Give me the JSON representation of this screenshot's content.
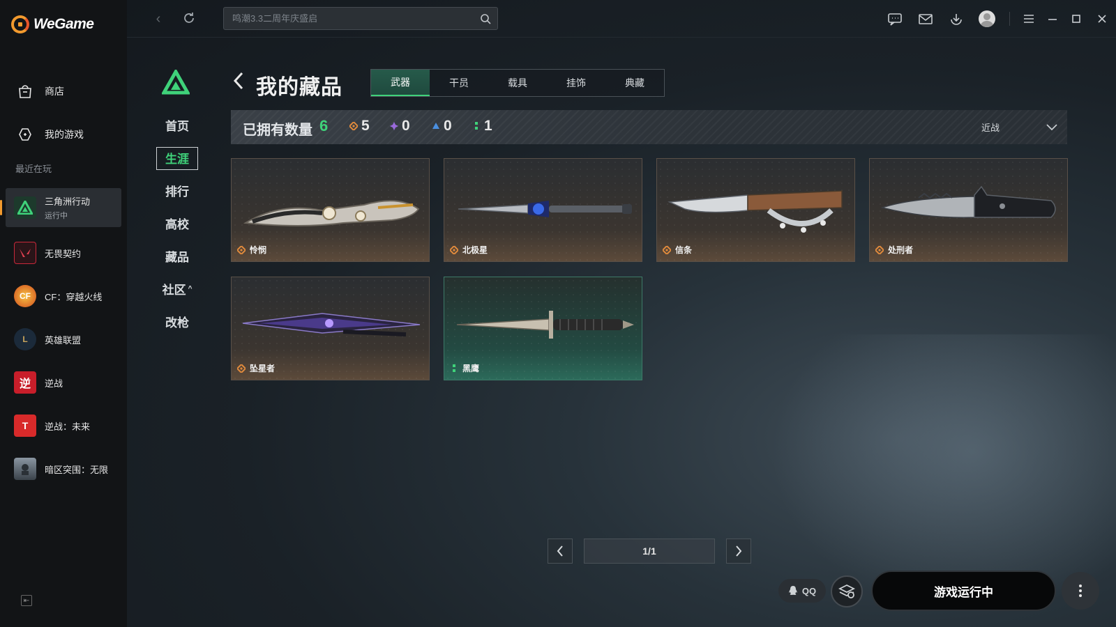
{
  "app": {
    "name": "WeGame"
  },
  "sidebar": {
    "nav": [
      {
        "label": "商店",
        "icon": "shop-bag-icon"
      },
      {
        "label": "我的游戏",
        "icon": "gamepad-icon"
      }
    ],
    "recent_title": "最近在玩",
    "recent": [
      {
        "label": "三角洲行动",
        "sub": "运行中",
        "active": true,
        "color": "#1d3a2c"
      },
      {
        "label": "无畏契约",
        "color": "#c8283a"
      },
      {
        "label": "CF：穿越火线",
        "color": "#d14b1c"
      },
      {
        "label": "英雄联盟",
        "color": "#1b2a3a"
      },
      {
        "label": "逆战",
        "color": "#c81e2a"
      },
      {
        "label": "逆战：未来",
        "color": "#d82a2a"
      },
      {
        "label": "暗区突围：无限",
        "color": "#5a6470"
      }
    ]
  },
  "topbar": {
    "search_placeholder": "鸣潮3.3二周年庆盛启"
  },
  "game_nav": {
    "items": [
      {
        "label": "首页"
      },
      {
        "label": "生涯",
        "active": true
      },
      {
        "label": "排行"
      },
      {
        "label": "高校"
      },
      {
        "label": "藏品"
      },
      {
        "label": "社区",
        "caret": "^"
      },
      {
        "label": "改枪"
      }
    ]
  },
  "page": {
    "title": "我的藏品",
    "tabs": [
      {
        "label": "武器",
        "active": true
      },
      {
        "label": "干员"
      },
      {
        "label": "载具"
      },
      {
        "label": "挂饰"
      },
      {
        "label": "典藏"
      }
    ]
  },
  "stats": {
    "label": "已拥有数量",
    "total": "6",
    "rarities": [
      {
        "value": "5",
        "color": "#e08a3c"
      },
      {
        "value": "0",
        "color": "#9a6adc"
      },
      {
        "value": "0",
        "color": "#4a8fe0"
      },
      {
        "value": "1",
        "color": "#3fd27a"
      }
    ],
    "sort_label": "近战"
  },
  "items": [
    {
      "name": "怜悯",
      "rarity_color": "#e08a3c",
      "style": "orange",
      "icon": "karambit-blade-icon"
    },
    {
      "name": "北极星",
      "rarity_color": "#e08a3c",
      "style": "orange",
      "icon": "dagger-blue-icon"
    },
    {
      "name": "信条",
      "rarity_color": "#e08a3c",
      "style": "orange",
      "icon": "knuckle-knife-icon"
    },
    {
      "name": "处刑者",
      "rarity_color": "#e08a3c",
      "style": "orange",
      "icon": "serrated-knife-icon"
    },
    {
      "name": "坠星者",
      "rarity_color": "#e08a3c",
      "style": "orange",
      "icon": "purple-blade-icon"
    },
    {
      "name": "黑鹰",
      "rarity_color": "#3fd27a",
      "style": "green",
      "icon": "combat-knife-icon"
    }
  ],
  "pagination": {
    "label": "1/1"
  },
  "bottom": {
    "qq_label": "QQ",
    "run_label": "游戏运行中"
  },
  "colors": {
    "accent_green": "#3fd27a",
    "accent_orange": "#f29a2e"
  }
}
